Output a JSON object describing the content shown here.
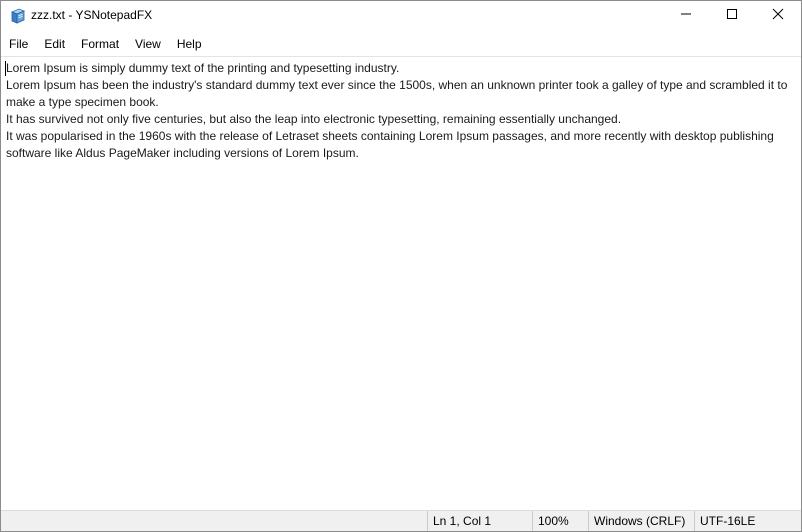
{
  "window": {
    "title": "zzz.txt - YSNotepadFX",
    "icon": "notepad-icon"
  },
  "window_controls": {
    "minimize_icon": "minimize-icon",
    "maximize_icon": "maximize-icon",
    "close_icon": "close-icon"
  },
  "menu": {
    "items": [
      {
        "label": "File"
      },
      {
        "label": "Edit"
      },
      {
        "label": "Format"
      },
      {
        "label": "View"
      },
      {
        "label": "Help"
      }
    ]
  },
  "editor": {
    "content": "Lorem Ipsum is simply dummy text of the printing and typesetting industry.\nLorem Ipsum has been the industry's standard dummy text ever since the 1500s, when an unknown printer took a galley of type and scrambled it to make a type specimen book.\nIt has survived not only five centuries, but also the leap into electronic typesetting, remaining essentially unchanged.\nIt was popularised in the 1960s with the release of Letraset sheets containing Lorem Ipsum passages, and more recently with desktop publishing software like Aldus PageMaker including versions of Lorem Ipsum."
  },
  "status": {
    "position": "Ln 1, Col 1",
    "zoom": "100%",
    "line_ending": "Windows (CRLF)",
    "encoding": "UTF-16LE"
  },
  "colors": {
    "statusbar_bg": "#f0f0f0",
    "window_border": "#8c8c8c",
    "icon_blue": "#3a7fc4"
  }
}
